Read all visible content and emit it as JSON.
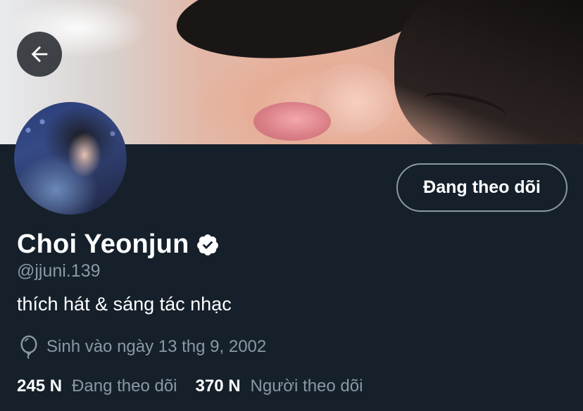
{
  "header": {
    "back_icon": "arrow-left-icon"
  },
  "profile": {
    "display_name": "Choi Yeonjun",
    "verified_icon": "verified-badge-icon",
    "handle": "@jjuni.139",
    "bio": "thích hát & sáng tác nhạc",
    "birthday_icon": "balloon-icon",
    "birthday": "Sinh vào ngày 13 thg 9, 2002"
  },
  "actions": {
    "follow_label": "Đang theo dõi"
  },
  "stats": {
    "following_count": "245 N",
    "following_label": "Đang theo dõi",
    "followers_count": "370 N",
    "followers_label": "Người theo dõi"
  },
  "colors": {
    "background": "#15202b",
    "secondary_text": "#8b98a5",
    "primary_text": "#ffffff"
  }
}
